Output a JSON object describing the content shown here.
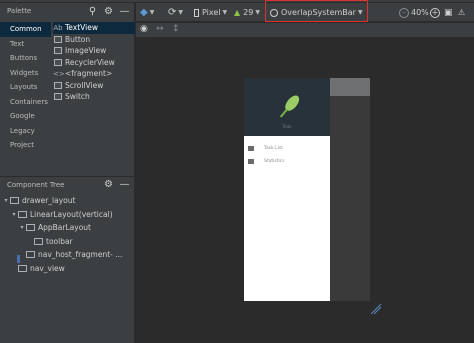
{
  "palette": {
    "title": "Palette",
    "categories": [
      "Common",
      "Text",
      "Buttons",
      "Widgets",
      "Layouts",
      "Containers",
      "Google",
      "Legacy",
      "Project"
    ],
    "items": [
      {
        "prefix": "Ab",
        "label": "TextView"
      },
      {
        "prefix": "",
        "label": "Button"
      },
      {
        "prefix": "",
        "label": "ImageView"
      },
      {
        "prefix": "",
        "label": "RecyclerView"
      },
      {
        "prefix": "<>",
        "label": "<fragment>"
      },
      {
        "prefix": "",
        "label": "ScrollView"
      },
      {
        "prefix": "",
        "label": "Switch"
      }
    ]
  },
  "component_tree": {
    "title": "Component Tree",
    "nodes": [
      "drawer_layout",
      "LinearLayout(vertical)",
      "AppBarLayout",
      "toolbar",
      "nav_host_fragment- ...",
      "nav_view"
    ]
  },
  "toolbar": {
    "device": "Pixel",
    "api": "29",
    "theme": "OverlapSystemBar",
    "zoom": "40%"
  },
  "preview": {
    "logo_label": "Todo",
    "menu": [
      "Task List",
      "Statistics"
    ]
  },
  "colors": {
    "accent_highlight": "#e0302c",
    "selection": "#0d293e",
    "logo_green": "#9ccc65"
  }
}
